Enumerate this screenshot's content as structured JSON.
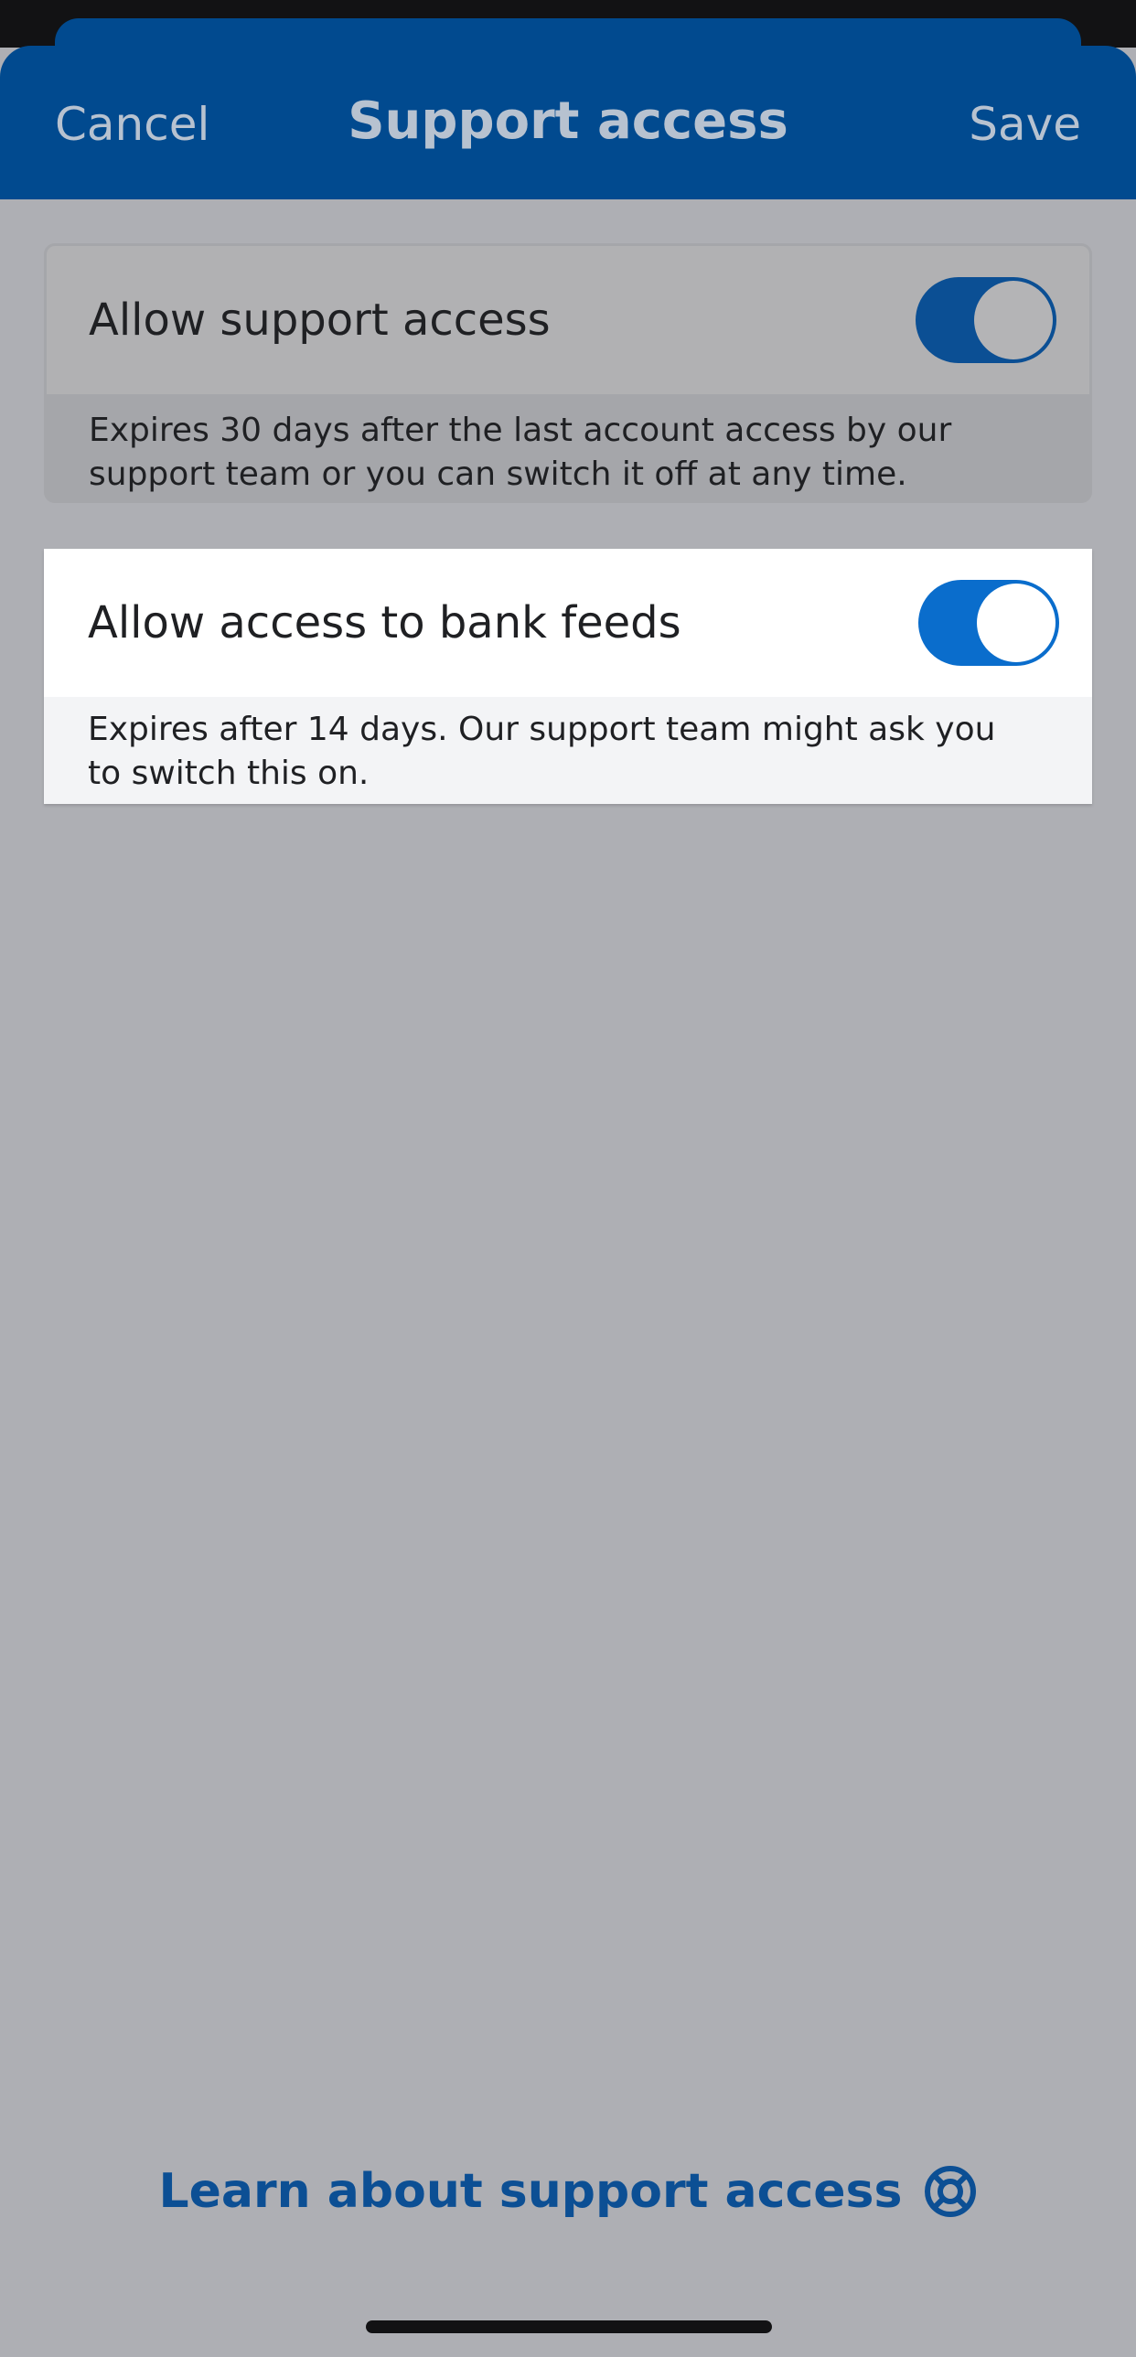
{
  "header": {
    "cancel_label": "Cancel",
    "title": "Support access",
    "save_label": "Save"
  },
  "settings": [
    {
      "label": "Allow support access",
      "enabled": true,
      "description": "Expires 30 days after the last account access by our support team or you can switch it off at any time."
    },
    {
      "label": "Allow access to bank feeds",
      "enabled": true,
      "description": "Expires after 14 days. Our support team might ask you to switch this on."
    }
  ],
  "footer": {
    "learn_link": "Learn about support access",
    "learn_icon": "lifebuoy-icon"
  },
  "colors": {
    "header_bg": "#014a8f",
    "toggle_on": "#0a6dcc",
    "link": "#0c4f94",
    "overlay_bg": "#aeafb4"
  }
}
